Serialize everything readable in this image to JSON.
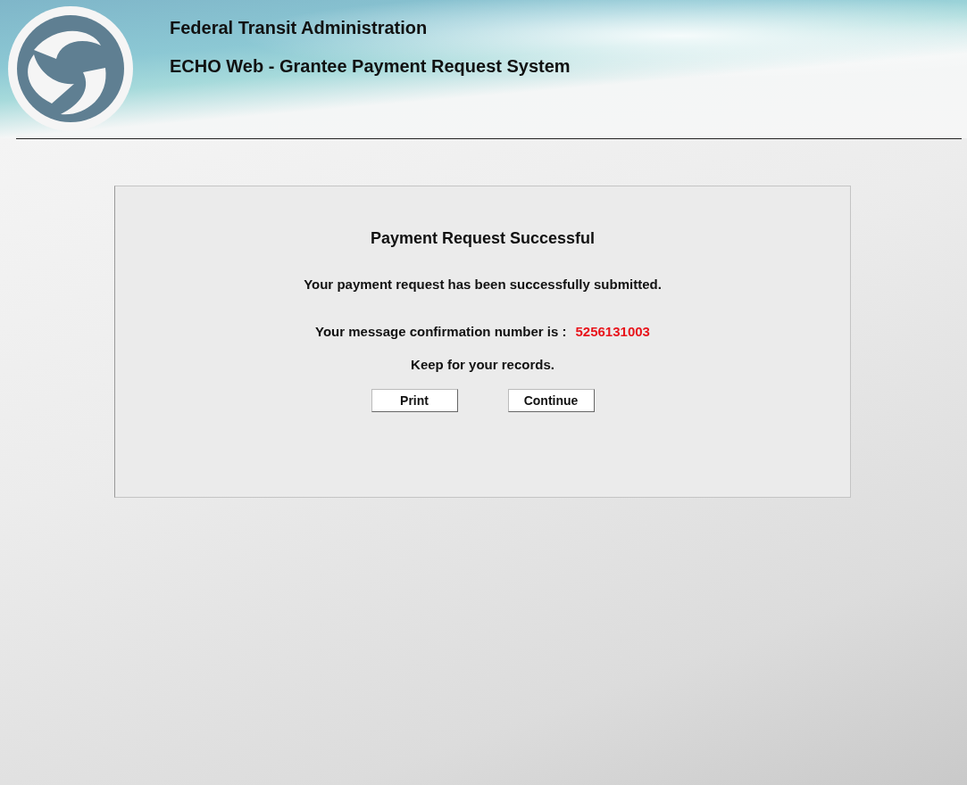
{
  "header": {
    "agency": "Federal Transit Administration",
    "system": "ECHO Web - Grantee Payment Request System"
  },
  "panel": {
    "title": "Payment Request Successful",
    "message": "Your payment request has been successfully submitted.",
    "confirmation_label": "Your message confirmation number is :",
    "confirmation_number": "5256131003",
    "note": "Keep for your records.",
    "buttons": [
      {
        "label": "Print"
      },
      {
        "label": "Continue"
      }
    ]
  }
}
